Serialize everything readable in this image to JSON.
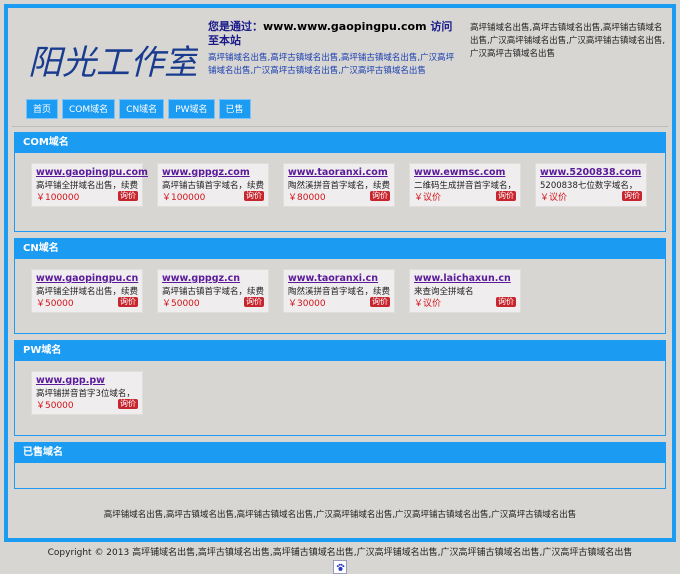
{
  "header": {
    "logo_text": "阳光工作室",
    "visit_prefix": "您是通过：",
    "visit_domain": "www.www.gaopingpu.com",
    "visit_suffix": " 访问至本站",
    "links_text": "高坪铺域名出售,高坪古镇域名出售,高坪铺古镇域名出售,广汉高坪铺域名出售,广汉高坪古镇域名出售,广汉高坪古镇域名出售",
    "right_text": "高坪铺域名出售,高坪古镇域名出售,高坪铺古镇域名出售,广汉高坪铺域名出售,广汉高坪铺古镇域名出售,广汉高坪古镇域名出售"
  },
  "nav": [
    {
      "label": "首页"
    },
    {
      "label": "COM域名"
    },
    {
      "label": "CN域名"
    },
    {
      "label": "PW域名"
    },
    {
      "label": "已售"
    }
  ],
  "sections": {
    "com": {
      "title": "COM域名",
      "items": [
        {
          "domain": "www.gaopingpu.com",
          "desc": "高坪铺全拼域名出售，续费",
          "price": "￥100000",
          "btn": "询价"
        },
        {
          "domain": "www.gppgz.com",
          "desc": "高坪铺古镇首字域名，续费",
          "price": "￥100000",
          "btn": "询价"
        },
        {
          "domain": "www.taoranxi.com",
          "desc": "陶然溪拼音首字域名，续费",
          "price": "￥80000",
          "btn": "询价"
        },
        {
          "domain": "www.ewmsc.com",
          "desc": "二维码生成拼音首字域名，",
          "price": "￥议价",
          "btn": "询价"
        },
        {
          "domain": "www.5200838.com",
          "desc": "5200838七位数字域名，",
          "price": "￥议价",
          "btn": "询价"
        }
      ]
    },
    "cn": {
      "title": "CN域名",
      "items": [
        {
          "domain": "www.gaopingpu.cn",
          "desc": "高坪铺全拼域名出售，续费",
          "price": "￥50000",
          "btn": "询价"
        },
        {
          "domain": "www.gppgz.cn",
          "desc": "高坪铺古镇首字域名，续费",
          "price": "￥50000",
          "btn": "询价"
        },
        {
          "domain": "www.taoranxi.cn",
          "desc": "陶然溪拼音首字域名，续费",
          "price": "￥30000",
          "btn": "询价"
        },
        {
          "domain": "www.laichaxun.cn",
          "desc": "来查询全拼域名",
          "price": "￥议价",
          "btn": "询价"
        }
      ]
    },
    "pw": {
      "title": "PW域名",
      "items": [
        {
          "domain": "www.gpp.pw",
          "desc": "高坪铺拼音首字3位域名，",
          "price": "￥50000",
          "btn": "询价"
        }
      ]
    },
    "sold": {
      "title": "已售域名"
    }
  },
  "footer": {
    "links_text": "高坪铺域名出售,高坪古镇域名出售,高坪铺古镇域名出售,广汉高坪铺域名出售,广汉高坪铺古镇域名出售,广汉高坪古镇域名出售",
    "copyright": "Copyright © 2013 高坪铺域名出售,高坪古镇域名出售,高坪铺古镇域名出售,广汉高坪铺域名出售,广汉高坪铺古镇域名出售,广汉高坪古镇域名出售",
    "icon": "paw-icon"
  },
  "colors": {
    "accent": "#1b9bf2",
    "price": "#d1141b",
    "domain": "#5a1a9a",
    "background": "#d8d6d3"
  }
}
